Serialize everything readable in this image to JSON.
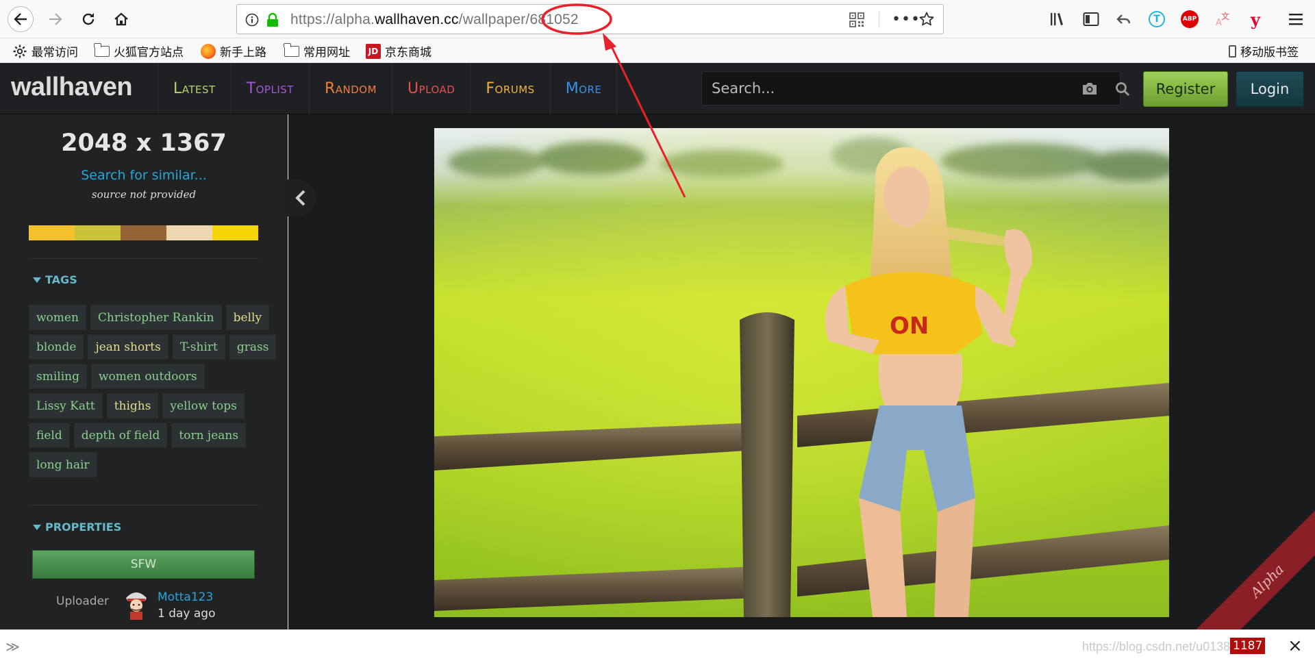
{
  "browser": {
    "url_prefix": "https://alpha.",
    "url_domain": "wallhaven.cc",
    "url_path": "/wallpaper/",
    "url_id": "681052",
    "abp_label": "ABP",
    "t_label": "T",
    "y_label": "y",
    "translate_label": "A",
    "translate_sub": "文"
  },
  "bookmarks": {
    "items": [
      "最常访问",
      "火狐官方站点",
      "新手上路",
      "常用网址",
      "京东商城"
    ],
    "jd_badge": "JD",
    "mobile": "移动版书签"
  },
  "site": {
    "logo": "wallhaven",
    "menu": [
      {
        "label": "Latest",
        "color": "#b3d468"
      },
      {
        "label": "Toplist",
        "color": "#a457d8"
      },
      {
        "label": "Random",
        "color": "#f07f3c"
      },
      {
        "label": "Upload",
        "color": "#e84f4f"
      },
      {
        "label": "Forums",
        "color": "#f0b43c"
      },
      {
        "label": "More",
        "color": "#3c8fe8"
      }
    ],
    "search_placeholder": "Search...",
    "register": "Register",
    "login": "Login"
  },
  "sidebar": {
    "resolution": "2048 x 1367",
    "similar": "Search for similar...",
    "source": "source not provided",
    "palette": [
      "#f4c12c",
      "#c8c338",
      "#946434",
      "#ecd7b0",
      "#f4d404"
    ],
    "tags_title": "TAGS",
    "tag_rows": [
      [
        {
          "label": "women",
          "c": "g"
        },
        {
          "label": "Christopher Rankin",
          "c": "g"
        },
        {
          "label": "belly",
          "c": "y"
        }
      ],
      [
        {
          "label": "blonde",
          "c": "g"
        },
        {
          "label": "jean shorts",
          "c": "y"
        },
        {
          "label": "T-shirt",
          "c": "g"
        },
        {
          "label": "grass",
          "c": "g"
        }
      ],
      [
        {
          "label": "smiling",
          "c": "g"
        },
        {
          "label": "women outdoors",
          "c": "g"
        }
      ],
      [
        {
          "label": "Lissy Katt",
          "c": "g"
        },
        {
          "label": "thighs",
          "c": "y"
        },
        {
          "label": "yellow tops",
          "c": "g"
        }
      ],
      [
        {
          "label": "field",
          "c": "g"
        },
        {
          "label": "depth of field",
          "c": "g"
        },
        {
          "label": "torn jeans",
          "c": "g"
        }
      ],
      [
        {
          "label": "long hair",
          "c": "g"
        }
      ]
    ],
    "properties_title": "PROPERTIES",
    "purity": "SFW",
    "uploader_label": "Uploader",
    "uploader_name": "Motta123",
    "uploader_time": "1 day ago"
  },
  "main": {
    "ribbon": "Alpha"
  },
  "bottom": {
    "watermark": "https://blog.csdn.net/u013833829",
    "counter": "1187",
    "close": "×"
  }
}
